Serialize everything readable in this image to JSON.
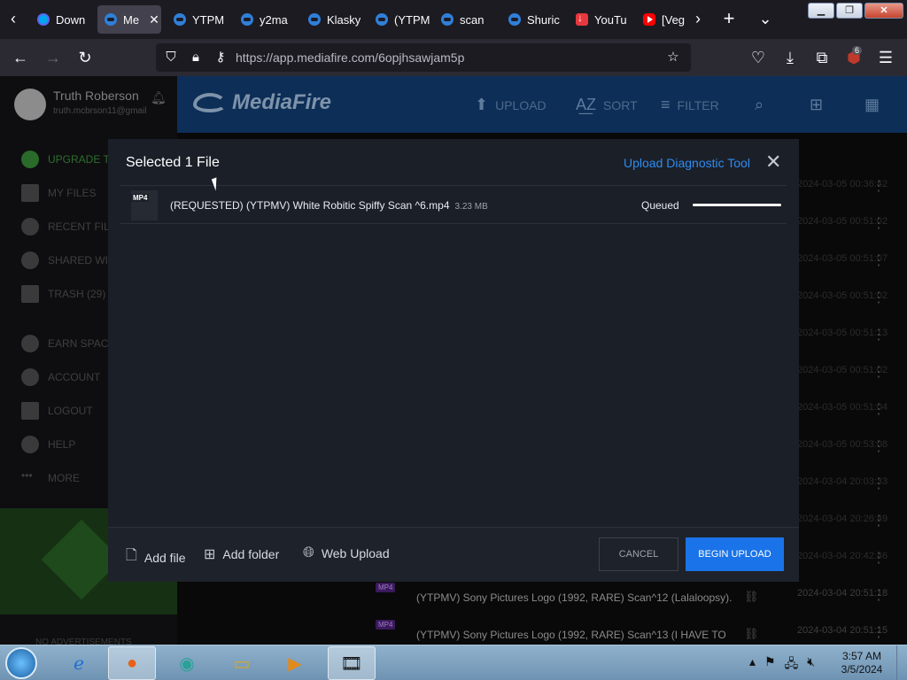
{
  "browser": {
    "tabs": [
      {
        "label": "Down",
        "icon": "firefox-icon"
      },
      {
        "label": "Me",
        "icon": "mediafire-icon",
        "active": true
      },
      {
        "label": "YTPM",
        "icon": "mediafire-icon"
      },
      {
        "label": "y2ma",
        "icon": "mediafire-icon"
      },
      {
        "label": "Klasky",
        "icon": "mediafire-icon"
      },
      {
        "label": "(YTPM",
        "icon": "mediafire-icon"
      },
      {
        "label": "scan",
        "icon": "mediafire-icon"
      },
      {
        "label": "Shuric",
        "icon": "mediafire-icon"
      },
      {
        "label": "YouTu",
        "icon": "download-icon"
      },
      {
        "label": "[Veg",
        "icon": "youtube-icon"
      }
    ],
    "url": "https://app.mediafire.com/6opjhsawjam5p",
    "extension_badge": "6",
    "window_buttons": [
      "minimize",
      "restore",
      "close"
    ]
  },
  "sidebar": {
    "user_name": "Truth Roberson",
    "user_email": "truth.mcbrson11@gmail",
    "items": [
      {
        "label": "UPGRADE T",
        "icon": "upgrade-icon"
      },
      {
        "label": "MY FILES",
        "icon": "folder-icon"
      },
      {
        "label": "RECENT FIL",
        "icon": "clock-icon"
      },
      {
        "label": "SHARED WI",
        "icon": "people-icon"
      },
      {
        "label": "TRASH (29)",
        "icon": "trash-icon"
      },
      {
        "label": "EARN SPAC",
        "icon": "plus-circle-icon"
      },
      {
        "label": "ACCOUNT",
        "icon": "gear-icon"
      },
      {
        "label": "LOGOUT",
        "icon": "logout-icon"
      },
      {
        "label": "HELP",
        "icon": "help-icon"
      },
      {
        "label": "MORE",
        "icon": "more-icon"
      }
    ],
    "no_ads": "NO ADVERTISEMENTS"
  },
  "topbar": {
    "logo": "MediaFire",
    "upload": "UPLOAD",
    "sort": "SORT",
    "filter": "FILTER"
  },
  "file_list": {
    "rows": [
      {
        "date": "2024-03-05 00:36:42"
      },
      {
        "date": "2024-03-05 00:51:02"
      },
      {
        "date": "2024-03-05 00:51:02"
      },
      {
        "date": "2024-03-05 00:51:07"
      },
      {
        "date": "2024-03-05 00:51:02"
      },
      {
        "date": "2024-03-05 00:51:13"
      },
      {
        "date": "2024-03-05 00:51:02"
      },
      {
        "date": "2024-03-05 00:51:04"
      },
      {
        "date": "2024-03-05 00:53:08"
      },
      {
        "date": "2024-03-04 20:03:33"
      },
      {
        "date": "2024-03-04 20:26:49"
      },
      {
        "date": "2024-03-04 20:42:46"
      }
    ],
    "visible_rows": [
      {
        "tag": "MP4",
        "name": "(YTPMV) Sony Pictures Logo (1992, RARE) Scan^12 (Lalaloopsy).",
        "date": "2024-03-04 20:51:18"
      },
      {
        "tag": "MP4",
        "name": "(YTPMV) Sony Pictures Logo (1992, RARE) Scan^13 (I HAVE TO",
        "date": "2024-03-04 20:51:15"
      }
    ]
  },
  "modal": {
    "title": "Selected 1 File",
    "diagnostic_link": "Upload Diagnostic Tool",
    "file": {
      "type_tag": "MP4",
      "name": "(REQUESTED) (YTPMV) White Robitic Spiffy Scan ^6.mp4",
      "size": "3.23 MB",
      "status": "Queued",
      "progress": 1.0
    },
    "footer": {
      "add_file": "Add file",
      "add_folder": "Add folder",
      "web_upload": "Web Upload",
      "cancel": "CANCEL",
      "begin_upload": "BEGIN UPLOAD"
    }
  },
  "taskbar": {
    "time": "3:57 AM",
    "date": "3/5/2024"
  }
}
